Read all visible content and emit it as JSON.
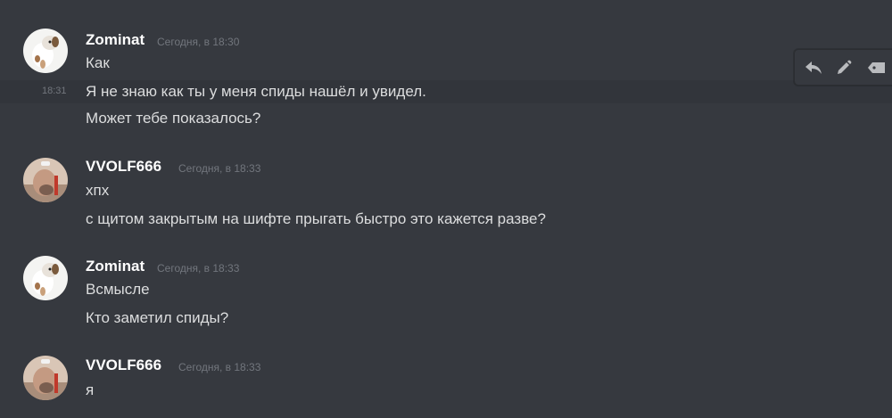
{
  "messages": [
    {
      "username": "Zominat",
      "timestamp": "Сегодня, в 18:30",
      "lines": [
        "Как",
        "Я не знаю как ты у меня спиды нашёл и увидел.",
        "Может тебе показалось?"
      ],
      "hover_time": "18:31"
    },
    {
      "username": "VVOLF666",
      "timestamp": "Сегодня, в 18:33",
      "lines": [
        "хпх",
        "с щитом закрытым на шифте прыгать быстро это кажется разве?"
      ]
    },
    {
      "username": "Zominat",
      "timestamp": "Сегодня, в 18:33",
      "lines": [
        "Всмысле",
        "Кто заметил спиды?"
      ]
    },
    {
      "username": "VVOLF666",
      "timestamp": "Сегодня, в 18:33",
      "lines": [
        "я"
      ]
    }
  ],
  "toolbar": {
    "icons": [
      "reply-icon",
      "edit-icon",
      "more-icon"
    ]
  },
  "colors": {
    "background": "#36393f",
    "username": "#ffffff",
    "text": "#dcddde",
    "muted": "#72767d"
  }
}
